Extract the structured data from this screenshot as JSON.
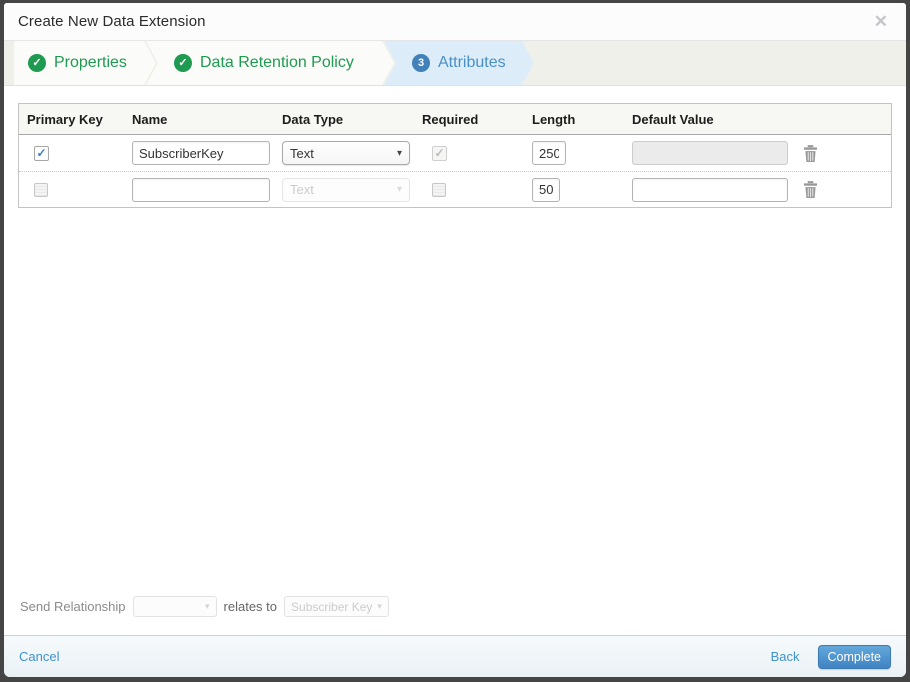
{
  "dialog": {
    "title": "Create New Data Extension"
  },
  "glyphs": {
    "check": "✓",
    "close": "✕",
    "dropdown_arrow": "▾"
  },
  "wizard": {
    "steps": [
      {
        "label": "Properties",
        "status": "complete"
      },
      {
        "label": "Data Retention Policy",
        "status": "complete"
      },
      {
        "label": "Attributes",
        "status": "active",
        "number": "3"
      }
    ]
  },
  "table": {
    "headers": {
      "primary_key": "Primary Key",
      "name": "Name",
      "data_type": "Data Type",
      "required": "Required",
      "length": "Length",
      "default_value": "Default Value"
    },
    "rows": [
      {
        "primary_key_checked": true,
        "name": "SubscriberKey",
        "data_type": "Text",
        "data_type_disabled": false,
        "required_checked": true,
        "required_disabled": true,
        "length": "250",
        "default_value": "",
        "default_value_disabled": true
      },
      {
        "primary_key_checked": false,
        "name": "",
        "data_type": "Text",
        "data_type_disabled": true,
        "required_checked": false,
        "required_disabled": false,
        "length": "50",
        "default_value": "",
        "default_value_disabled": false
      }
    ]
  },
  "send_relationship": {
    "label": "Send Relationship",
    "relates_to": "relates to",
    "target": "Subscriber Key"
  },
  "footer": {
    "cancel": "Cancel",
    "back": "Back",
    "complete": "Complete"
  },
  "colors": {
    "accent_green": "#1f9b51",
    "accent_blue": "#4a90c8",
    "button_blue": "#4487c6",
    "active_step_bg": "#dcedf9"
  }
}
